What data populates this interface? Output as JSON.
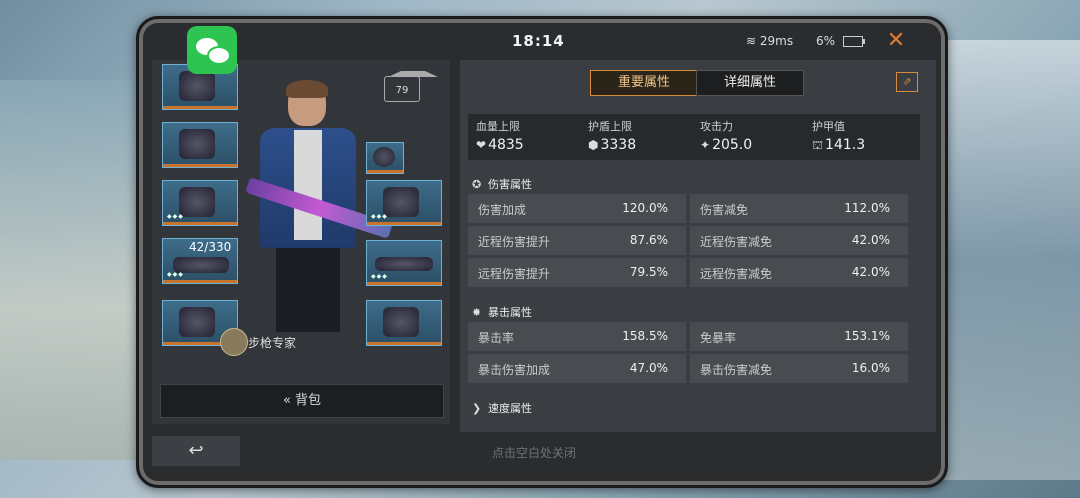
{
  "status": {
    "time": "18:14",
    "ping": "29ms",
    "battery": "6%"
  },
  "tabs": {
    "primary": "重要属性",
    "detail": "详细属性"
  },
  "level": "79",
  "ammo": "42/330",
  "expert_label": "步枪专家",
  "backpack_label": "背包",
  "summary": [
    {
      "label": "血量上限",
      "icon": "❤",
      "value": "4835"
    },
    {
      "label": "护盾上限",
      "icon": "⬢",
      "value": "3338"
    },
    {
      "label": "攻击力",
      "icon": "✦",
      "value": "205.0"
    },
    {
      "label": "护甲值",
      "icon": "⛫",
      "value": "141.3"
    }
  ],
  "damage": {
    "title": "伤害属性",
    "rows": [
      [
        {
          "k": "伤害加成",
          "v": "120.0%"
        },
        {
          "k": "伤害减免",
          "v": "112.0%"
        }
      ],
      [
        {
          "k": "近程伤害提升",
          "v": "87.6%"
        },
        {
          "k": "近程伤害减免",
          "v": "42.0%"
        }
      ],
      [
        {
          "k": "远程伤害提升",
          "v": "79.5%"
        },
        {
          "k": "远程伤害减免",
          "v": "42.0%"
        }
      ]
    ]
  },
  "crit": {
    "title": "暴击属性",
    "rows": [
      [
        {
          "k": "暴击率",
          "v": "158.5%"
        },
        {
          "k": "免暴率",
          "v": "153.1%"
        }
      ],
      [
        {
          "k": "暴击伤害加成",
          "v": "47.0%"
        },
        {
          "k": "暴击伤害减免",
          "v": "16.0%"
        }
      ]
    ]
  },
  "speed": {
    "title": "速度属性"
  },
  "hint": "点击空白处关闭"
}
